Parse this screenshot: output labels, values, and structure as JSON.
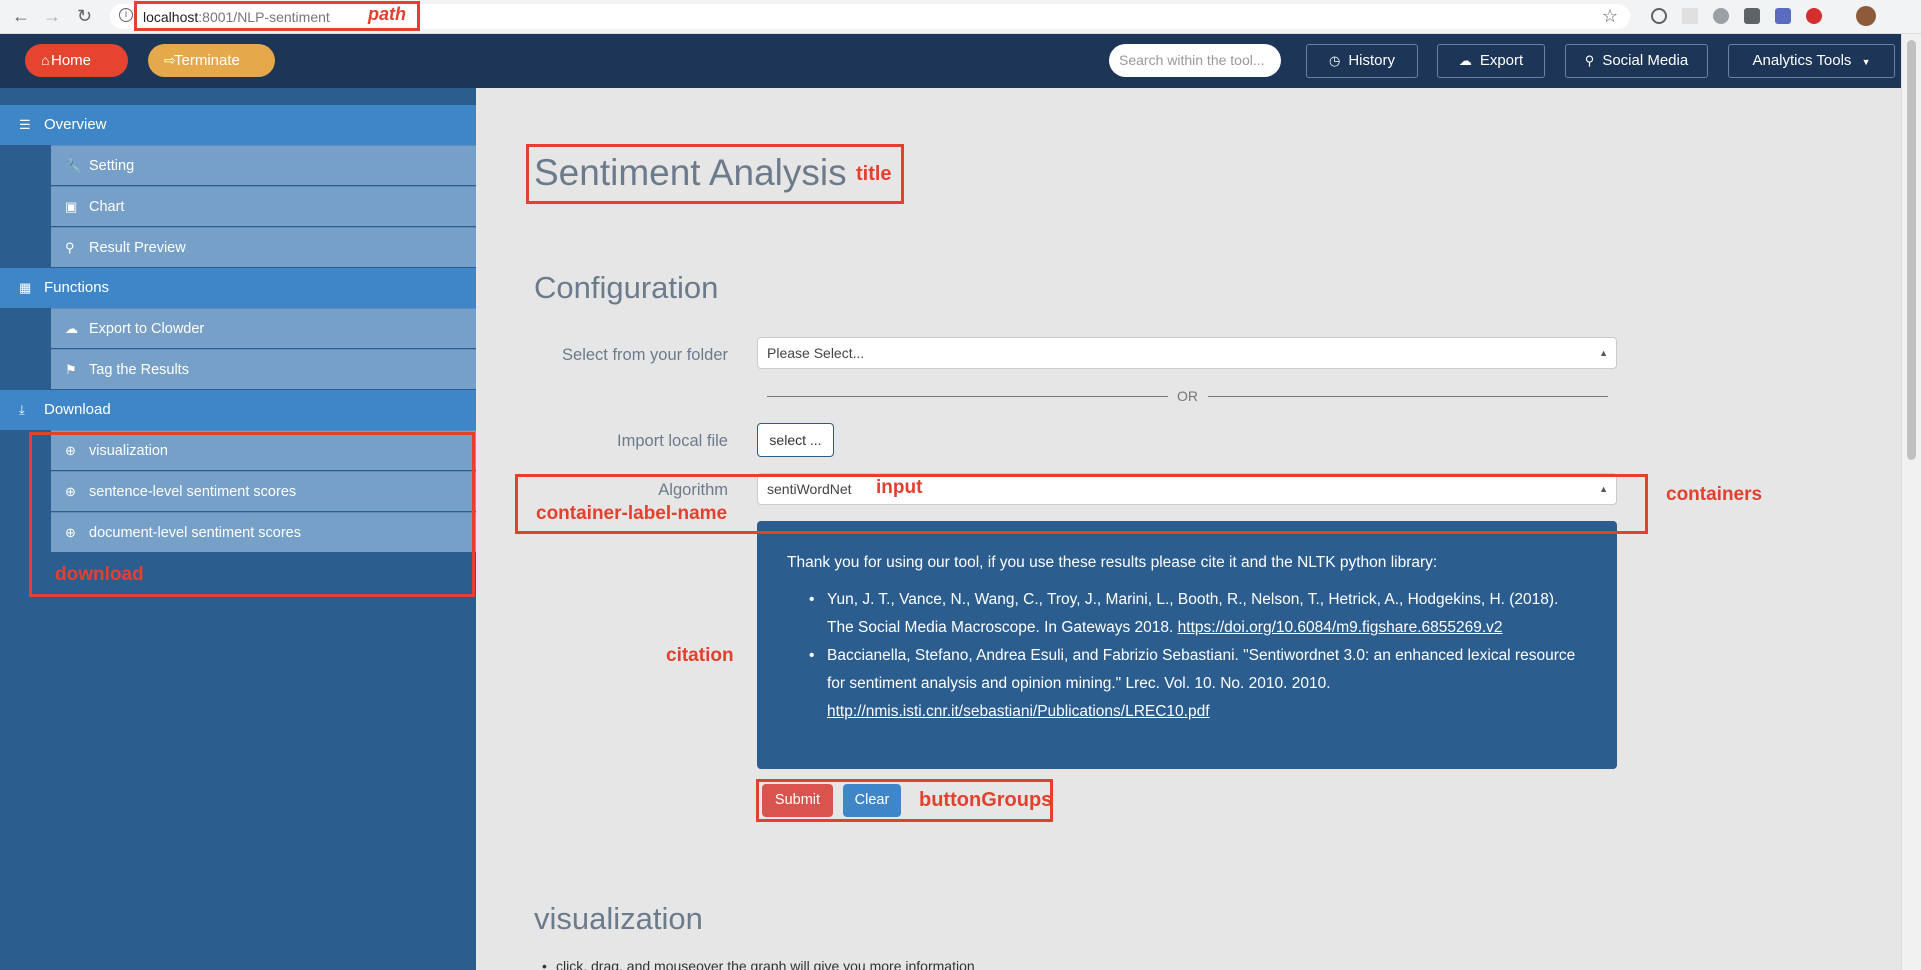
{
  "browser": {
    "url_host": "localhost",
    "url_rest": ":8001/NLP-sentiment",
    "back_icon": "back-arrow-icon",
    "forward_icon": "forward-arrow-icon",
    "reload_icon": "reload-icon",
    "star_icon": "bookmark-star-icon"
  },
  "topbar": {
    "home_label": "Home",
    "terminate_label": "Terminate",
    "search_placeholder": "Search within the tool...",
    "history_label": "History",
    "export_label": "Export",
    "social_label": "Social Media",
    "analytics_label": "Analytics Tools"
  },
  "sidebar": {
    "overview": "Overview",
    "overview_items": [
      "Setting",
      "Chart",
      "Result Preview"
    ],
    "functions": "Functions",
    "functions_items": [
      "Export to Clowder",
      "Tag the Results"
    ],
    "download": "Download",
    "download_items": [
      "visualization",
      "sentence-level sentiment scores",
      "document-level sentiment scores"
    ]
  },
  "main": {
    "title": "Sentiment Analysis",
    "configuration": "Configuration",
    "folder_label": "Select from your folder",
    "folder_value": "Please Select...",
    "or_text": "OR",
    "import_label": "Import local file",
    "import_button": "select ...",
    "algorithm_label": "Algorithm",
    "algorithm_value": "sentiWordNet",
    "citation_intro": "Thank you for using our tool, if you use these results please cite it and the NLTK python library:",
    "citation_1_text": "Yun, J. T., Vance, N., Wang, C., Troy, J., Marini, L., Booth, R., Nelson, T., Hetrick, A., Hodgekins, H. (2018). The Social Media Macroscope. In Gateways 2018.",
    "citation_1_link": " https://doi.org/10.6084/m9.figshare.6855269.v2",
    "citation_2_text": "Baccianella, Stefano, Andrea Esuli, and Fabrizio Sebastiani. \"Sentiwordnet 3.0: an enhanced lexical resource for sentiment analysis and opinion mining.\" Lrec. Vol. 10. No. 2010. 2010.",
    "citation_2_link": "http://nmis.isti.cnr.it/sebastiani/Publications/LREC10.pdf",
    "submit_label": "Submit",
    "clear_label": "Clear",
    "visualization": "visualization",
    "vis_bullet": "click, drag, and mouseover the graph will give you more information"
  },
  "annotations": {
    "path": "path",
    "title": "title",
    "input": "input",
    "containers": "containers",
    "container_label_name": "container-label-name",
    "citation": "citation",
    "download": "download",
    "button_groups": "buttonGroups"
  },
  "colors": {
    "annotation": "#e3402d",
    "navbar": "#1d3557",
    "sidebar": "#2b5d8f",
    "sidebar_header": "#3f86c9",
    "sidebar_item": "#76a0c8",
    "home": "#e5452f",
    "terminate": "#e5a84a",
    "submit": "#d9534f",
    "clear": "#3f86c9"
  }
}
